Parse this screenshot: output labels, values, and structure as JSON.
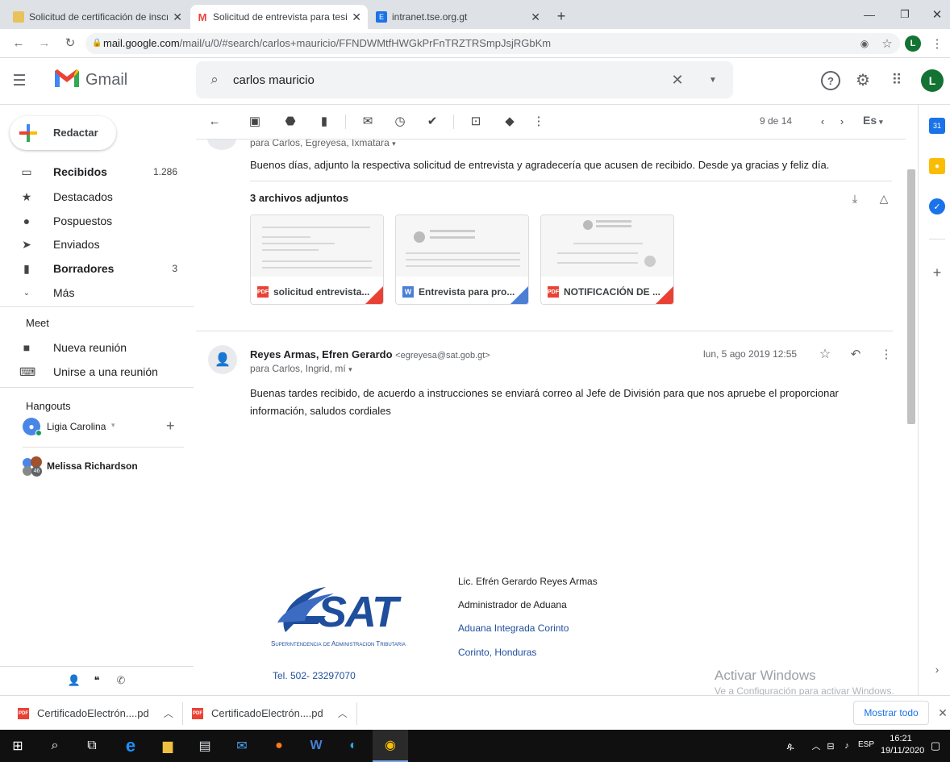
{
  "browser": {
    "tabs": [
      {
        "title": "Solicitud de certificación de inscr",
        "active": false
      },
      {
        "title": "Solicitud de entrevista para tesis",
        "active": true
      },
      {
        "title": "intranet.tse.org.gt",
        "active": false
      }
    ],
    "url_host": "mail.google.com",
    "url_path": "/mail/u/0/#search/carlos+mauricio/FFNDWMtfHWGkPrFnTRZTRSmpJsjRGbKm",
    "profile_initial": "L"
  },
  "gmail": {
    "brand": "Gmail",
    "search_query": "carlos mauricio",
    "avatar_initial": "L",
    "compose_label": "Redactar",
    "nav": [
      {
        "label": "Recibidos",
        "count": "1.286",
        "bold": true,
        "icon": "inbox-icon"
      },
      {
        "label": "Destacados",
        "count": "",
        "bold": false,
        "icon": "star-icon"
      },
      {
        "label": "Pospuestos",
        "count": "",
        "bold": false,
        "icon": "clock-icon"
      },
      {
        "label": "Enviados",
        "count": "",
        "bold": false,
        "icon": "send-icon"
      },
      {
        "label": "Borradores",
        "count": "3",
        "bold": true,
        "icon": "file-icon"
      },
      {
        "label": "Más",
        "count": "",
        "bold": false,
        "icon": "chevron-down-icon"
      }
    ],
    "meet_title": "Meet",
    "meet_items": [
      {
        "label": "Nueva reunión",
        "icon": "video-icon"
      },
      {
        "label": "Unirse a una reunión",
        "icon": "keyboard-icon"
      }
    ],
    "hangouts_title": "Hangouts",
    "hangouts_user": "Ligia Carolina",
    "hangouts_contact": "Melissa Richardson",
    "hangouts_contact_badge": "46",
    "pagination": "9 de 14",
    "lang": "Es"
  },
  "thread": {
    "msg1_recipients": "para Carlos, Egreyesa, Ixmatara",
    "msg1_body": "Buenos días, adjunto la respectiva solicitud de entrevista y agradecería que acusen de recibido. Desde ya gracias y feliz día.",
    "attachments_title": "3 archivos adjuntos",
    "attachments": [
      {
        "name": "solicitud entrevista...",
        "type": "PDF",
        "badge_color": "#e94235"
      },
      {
        "name": "Entrevista para pro...",
        "type": "W",
        "badge_color": "#4a7fd4"
      },
      {
        "name": "NOTIFICACIÓN DE ...",
        "type": "PDF",
        "badge_color": "#e94235"
      }
    ],
    "msg2_sender": "Reyes Armas, Efren Gerardo",
    "msg2_email": "<egreyesa@sat.gob.gt>",
    "msg2_date": "lun, 5 ago 2019 12:55",
    "msg2_recipients": "para Carlos, Ingrid, mí",
    "msg2_body_line1": "Buenas tardes recibido, de acuerdo a instrucciones  se enviará correo al Jefe de División para que nos apruebe el proporcionar",
    "msg2_body_line2": "información, saludos cordiales",
    "sig_logo": "SAT",
    "sig_logo_sub": "Superintendencia de Administracion Tributaria",
    "sig_name": "Lic. Efrén Gerardo Reyes Armas",
    "sig_title": "Administrador de Aduana",
    "sig_office": "Aduana Integrada Corinto",
    "sig_place": "Corinto, Honduras",
    "sig_phone": "Tel. 502- 23297070"
  },
  "watermark": {
    "line1": "Activar Windows",
    "line2": "Ve a Configuración para activar Windows."
  },
  "downloads": {
    "items": [
      "CertificadoElectrón....pd",
      "CertificadoElectrón....pd"
    ],
    "show_all": "Mostrar todo"
  },
  "taskbar": {
    "lang": "ESP",
    "time": "16:21",
    "date": "19/11/2020"
  },
  "colors": {
    "accent": "#1a73e8",
    "pdf_red": "#e94235",
    "word_blue": "#4a7fd4",
    "sig_blue": "#1f4e9c"
  }
}
